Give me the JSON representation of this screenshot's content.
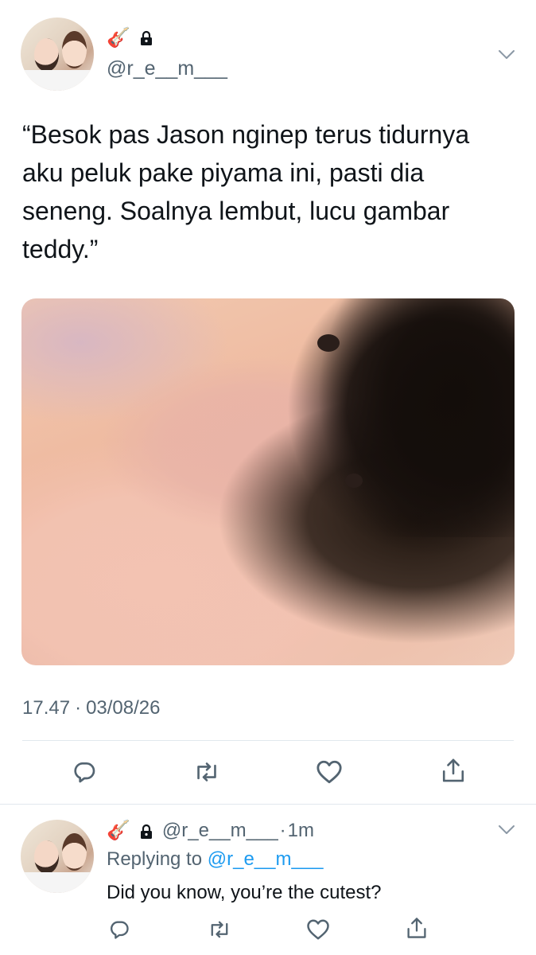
{
  "tweet": {
    "handle": "@r_e__m___",
    "text": "“Besok pas Jason nginep terus tidurnya aku peluk pake piyama ini, pasti dia seneng. Soalnya lembut, lucu gambar teddy.”",
    "time": "17.47",
    "separator": "·",
    "date": "03/08/26",
    "emoji": "🎸"
  },
  "reply": {
    "handle": "@r_e__m___",
    "separator": "·",
    "time_ago": "1m",
    "replying_label": "Replying to",
    "replying_to": "@r_e__m___",
    "text": "Did you know, you’re the cutest?",
    "emoji": "🎸"
  },
  "icons": {
    "reply": "reply-icon",
    "retweet": "retweet-icon",
    "like": "heart-icon",
    "share": "share-icon",
    "more": "chevron-down-icon",
    "protected": "lock-icon"
  },
  "colors": {
    "text": "#0f1419",
    "secondary": "#536471",
    "link": "#1d9bf0",
    "divider": "#e1e8ed"
  }
}
